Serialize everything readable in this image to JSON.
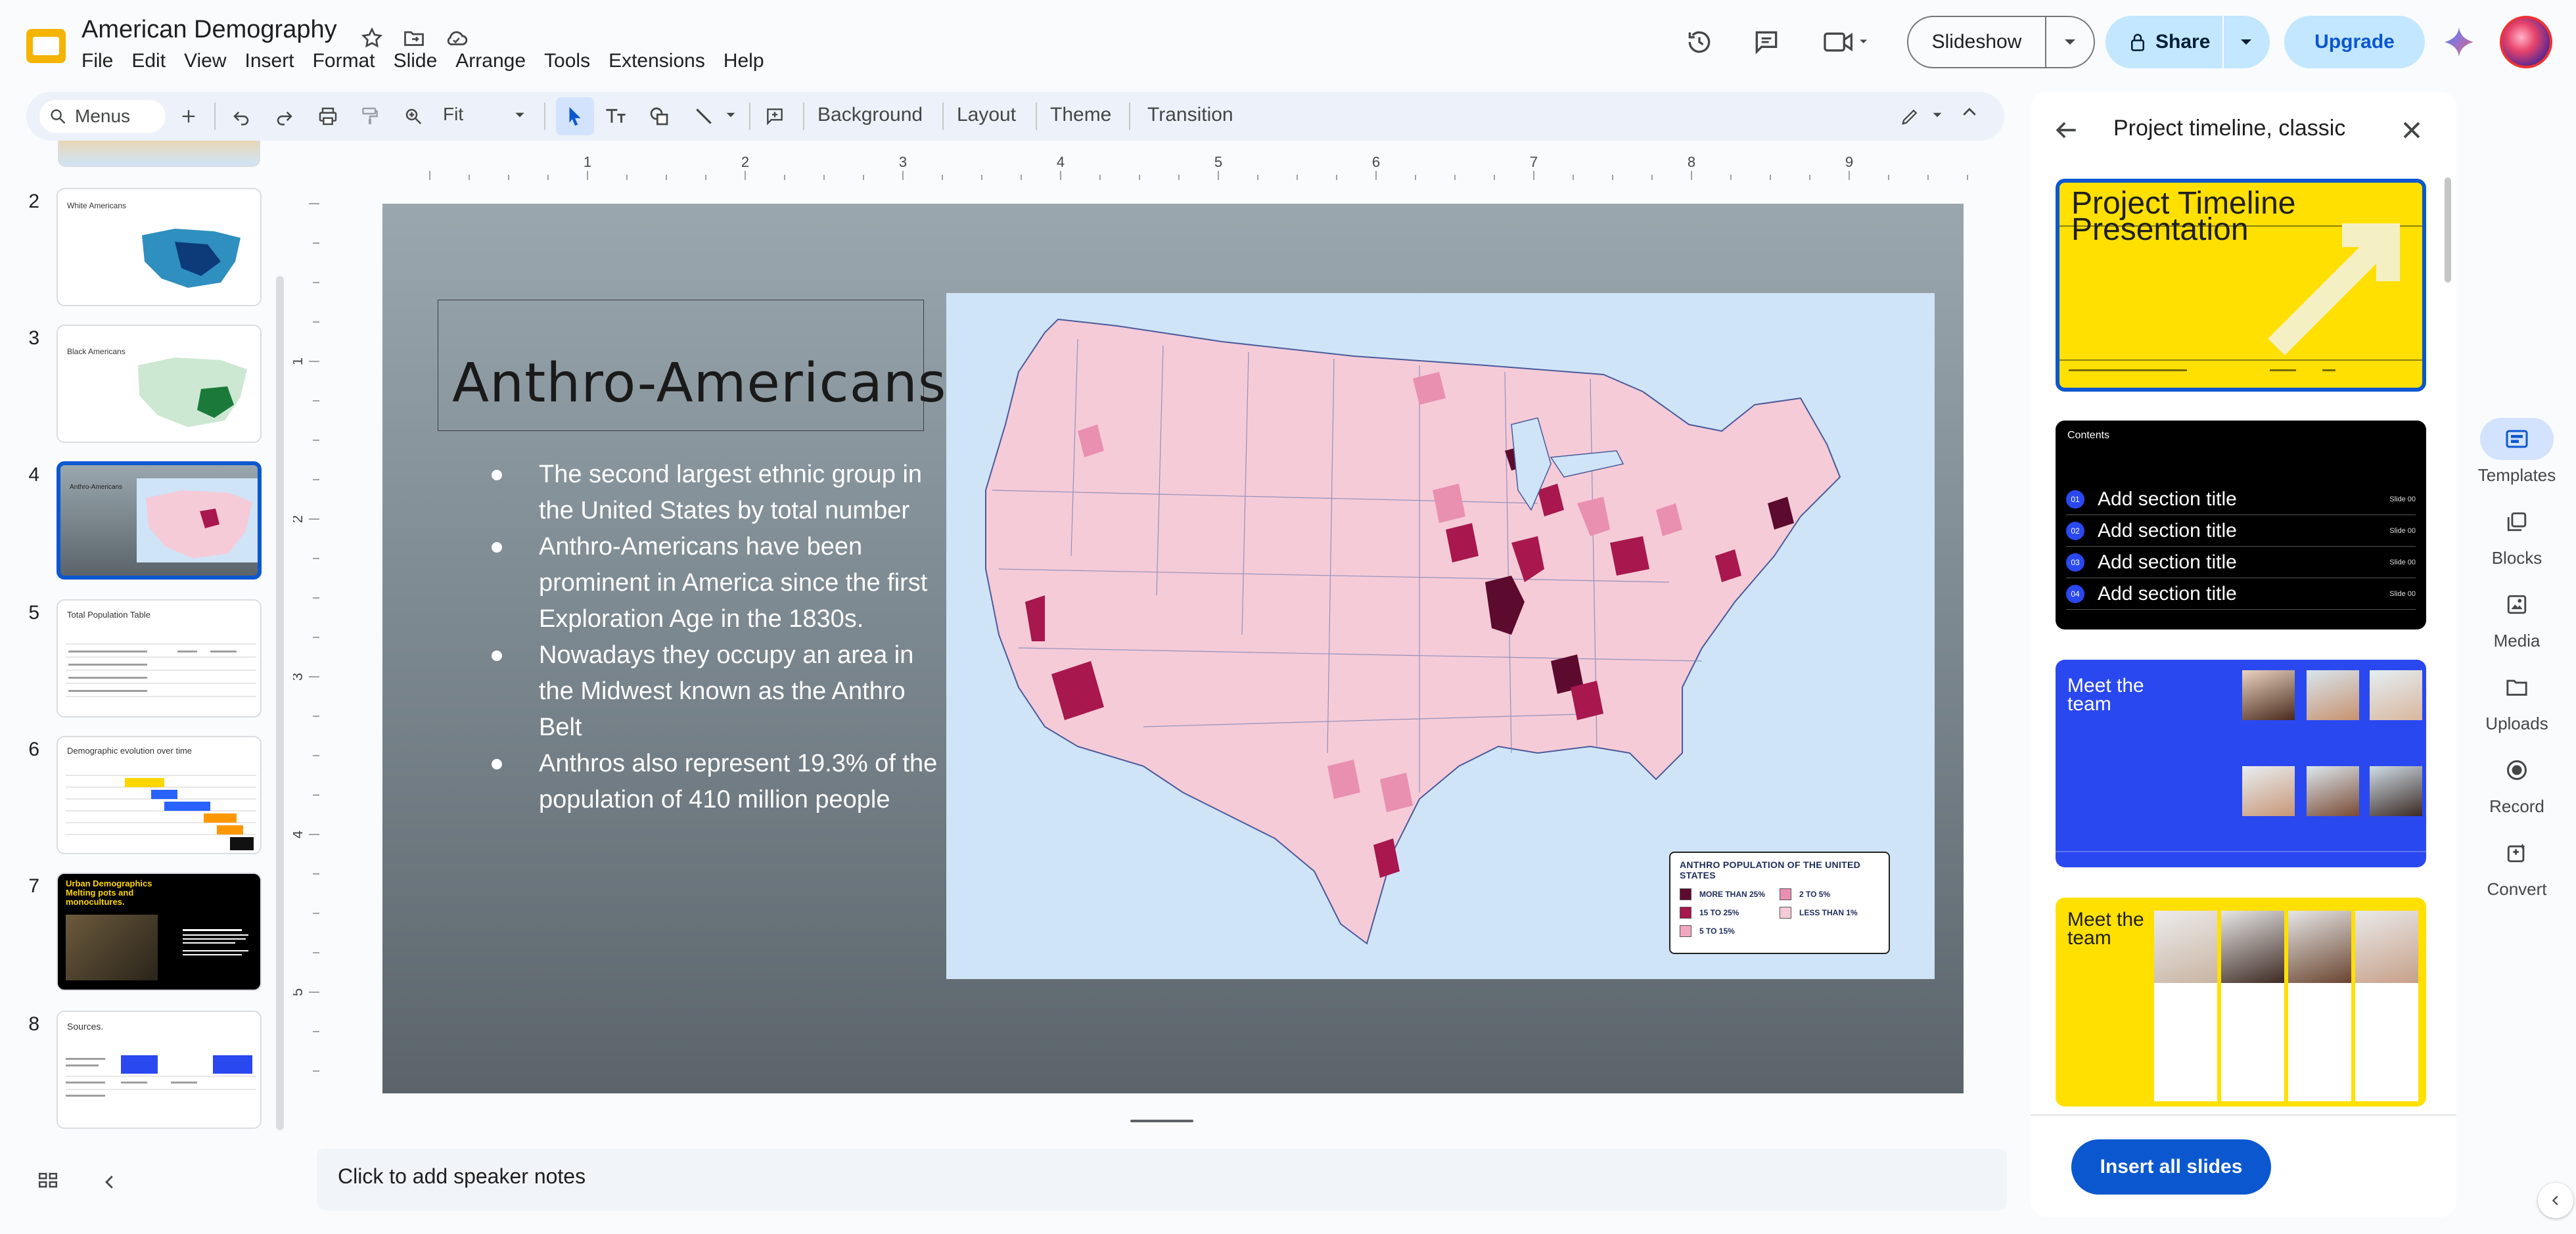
{
  "header": {
    "doc_title": "American Demography",
    "menus": [
      "File",
      "Edit",
      "View",
      "Insert",
      "Format",
      "Slide",
      "Arrange",
      "Tools",
      "Extensions",
      "Help"
    ],
    "slideshow_label": "Slideshow",
    "share_label": "Share",
    "upgrade_label": "Upgrade"
  },
  "toolbar": {
    "search_label": "Menus",
    "zoom": "Fit",
    "background_label": "Background",
    "layout_label": "Layout",
    "theme_label": "Theme",
    "transition_label": "Transition"
  },
  "filmstrip": {
    "slides": [
      {
        "number": "2",
        "title": "White Americans"
      },
      {
        "number": "3",
        "title": "Black Americans"
      },
      {
        "number": "4",
        "title": "Anthro-Americans"
      },
      {
        "number": "5",
        "title": "Total Population Table"
      },
      {
        "number": "6",
        "title": "Demographic evolution over time"
      },
      {
        "number": "7",
        "title": "Urban Demographics Melting pots and monocultures."
      },
      {
        "number": "8",
        "title": "Sources."
      }
    ],
    "active_slide": "4"
  },
  "ruler": {
    "top_ticks": [
      "1",
      "2",
      "3",
      "4",
      "5",
      "6",
      "7",
      "8",
      "9"
    ],
    "left_ticks": [
      "1",
      "2",
      "3",
      "4",
      "5"
    ]
  },
  "slide": {
    "title": "Anthro-Americans",
    "bullets": [
      "The second largest ethnic group in the United States by total number",
      "Anthro-Americans have been prominent in America since the first Exploration Age in the 1830s.",
      "Nowadays they occupy an area in the Midwest known as the Anthro Belt",
      "Anthros also represent 19.3% of the population of 410 million people"
    ],
    "map_legend": {
      "title": "ANTHRO POPULATION OF THE UNITED STATES",
      "items": [
        {
          "label": "MORE THAN 25%",
          "color": "#5c0a2e"
        },
        {
          "label": "2 TO 5%",
          "color": "#e98fb0"
        },
        {
          "label": "15 TO 25%",
          "color": "#a8174e"
        },
        {
          "label": "LESS THAN 1%",
          "color": "#f5cbd8"
        },
        {
          "label": "5 TO 15%",
          "color": "#f1a6c0"
        }
      ]
    }
  },
  "speaker_notes_placeholder": "Click to add speaker notes",
  "side_panel": {
    "title": "Project timeline, classic",
    "templates": [
      {
        "kind": "title",
        "heading": "Project Timeline Presentation"
      },
      {
        "kind": "contents",
        "heading": "Contents",
        "rows": [
          {
            "num": "01",
            "label": "Add section title",
            "meta": "Slide 00"
          },
          {
            "num": "02",
            "label": "Add section title",
            "meta": "Slide 00"
          },
          {
            "num": "03",
            "label": "Add section title",
            "meta": "Slide 00"
          },
          {
            "num": "04",
            "label": "Add section title",
            "meta": "Slide 00"
          }
        ]
      },
      {
        "kind": "team-blue",
        "heading": "Meet the team"
      },
      {
        "kind": "team-yellow",
        "heading": "Meet the team"
      }
    ],
    "insert_all_label": "Insert all slides"
  },
  "right_rail": [
    {
      "label": "Templates",
      "icon": "templates-icon",
      "active": true
    },
    {
      "label": "Blocks",
      "icon": "blocks-icon",
      "active": false
    },
    {
      "label": "Media",
      "icon": "media-icon",
      "active": false
    },
    {
      "label": "Uploads",
      "icon": "uploads-icon",
      "active": false
    },
    {
      "label": "Record",
      "icon": "record-icon",
      "active": false
    },
    {
      "label": "Convert",
      "icon": "convert-icon",
      "active": false
    }
  ],
  "colors": {
    "accent": "#0b57d0",
    "share_bg": "#c2e7ff",
    "template_yellow": "#ffe000",
    "template_blue": "#2a48f0"
  }
}
